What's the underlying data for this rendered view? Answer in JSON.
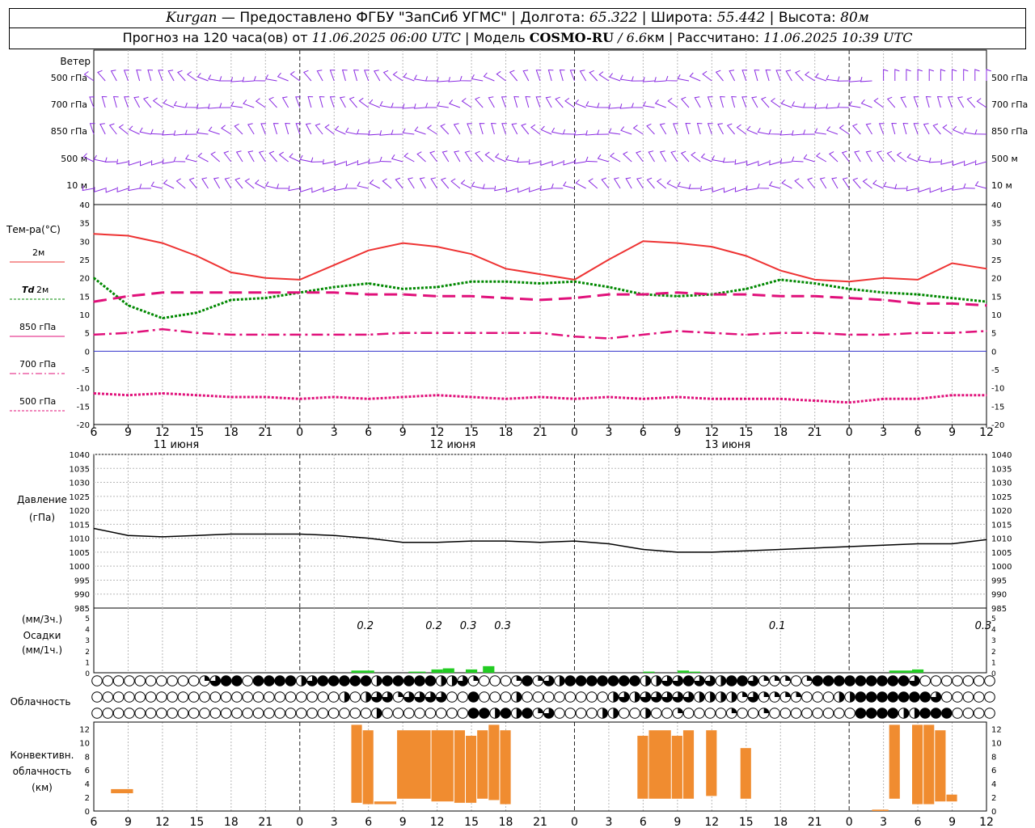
{
  "header": {
    "station": "Kurgan",
    "dash": " — ",
    "provider": "Предоставлено ФГБУ \"ЗапСиб УГМС\"",
    "sep": " | ",
    "lon_label": "Долгота: ",
    "lon_value": "65.322",
    "lat_label": "Широта: ",
    "lat_value": "55.442",
    "alt_label": "Высота: ",
    "alt_value": "80м",
    "forecast_label": "Прогноз на 120 часа(ов) от ",
    "forecast_time": "11.06.2025 06:00 UTC",
    "model_label": "Модель ",
    "model_name": "COSMO-RU",
    "model_res_sep": " / ",
    "model_res": "6.6",
    "model_res_unit": "км",
    "calc_label": "Рассчитано: ",
    "calc_time": "11.06.2025 10:39 UTC"
  },
  "chart_data": [
    {
      "type": "wind-barbs",
      "label": "Ветер",
      "levels": [
        "500 гПа",
        "700 гПа",
        "850 гПа",
        "500 м",
        "10 м"
      ],
      "barb_color": "#8a2be2"
    },
    {
      "type": "line",
      "label": "Тем-ра(°C)",
      "ylim": [
        -20,
        40
      ],
      "yticks": [
        -20,
        -15,
        -10,
        -5,
        0,
        5,
        10,
        15,
        20,
        25,
        30,
        35,
        40
      ],
      "x_hours": [
        0,
        3,
        6,
        9,
        12,
        15,
        18,
        21,
        24,
        27,
        30,
        33,
        36,
        39,
        42,
        45,
        48,
        51,
        54,
        57,
        60,
        63,
        66,
        69,
        72,
        75,
        78
      ],
      "series": [
        {
          "name": "2м",
          "color": "#ee3333",
          "style": "solid",
          "values": [
            32,
            31.5,
            29.5,
            26,
            21.5,
            20,
            19.5,
            23.5,
            27.5,
            29.5,
            28.5,
            26.5,
            22.5,
            21,
            19.5,
            25,
            30,
            29.5,
            28.5,
            26,
            22,
            19.5,
            19,
            20,
            19.5,
            24,
            22.5
          ]
        },
        {
          "name": "Td 2м",
          "color": "#008800",
          "style": "dotted",
          "values": [
            20,
            12.5,
            9,
            10.5,
            14,
            14.5,
            16,
            17.5,
            18.5,
            17,
            17.5,
            19,
            19,
            18.5,
            19,
            17.5,
            15.5,
            15,
            15.5,
            17,
            19.5,
            18.5,
            17,
            16,
            15.5,
            14.5,
            13.5
          ]
        },
        {
          "name": "850 гПа",
          "color": "#e0107a",
          "style": "dashed",
          "values": [
            13.5,
            15,
            16,
            16,
            16,
            16,
            16,
            16,
            15.5,
            15.5,
            15,
            15,
            14.5,
            14,
            14.5,
            15.5,
            15.5,
            16,
            15.5,
            15.5,
            15,
            15,
            14.5,
            14,
            13,
            13,
            12.5
          ]
        },
        {
          "name": "700 гПа",
          "color": "#e0107a",
          "style": "dashdot",
          "values": [
            4.5,
            5,
            6,
            5,
            4.5,
            4.5,
            4.5,
            4.5,
            4.5,
            5,
            5,
            5,
            5,
            5,
            4,
            3.5,
            4.5,
            5.5,
            5,
            4.5,
            5,
            5,
            4.5,
            4.5,
            5,
            5,
            5.5
          ]
        },
        {
          "name": "500 гПа",
          "color": "#e0107a",
          "style": "dotted",
          "values": [
            -11.5,
            -12,
            -11.5,
            -12,
            -12.5,
            -12.5,
            -13,
            -12.5,
            -13,
            -12.5,
            -12,
            -12.5,
            -13,
            -12.5,
            -13,
            -12.5,
            -13,
            -12.5,
            -13,
            -13,
            -13,
            -13.5,
            -14,
            -13,
            -13,
            -12,
            -12
          ]
        }
      ],
      "day_labels": [
        "11 июня",
        "12 июня",
        "13 июня"
      ],
      "x_tick_labels": [
        "6",
        "9",
        "12",
        "15",
        "18",
        "21",
        "0",
        "3",
        "6",
        "9",
        "12",
        "15",
        "18",
        "21",
        "0",
        "3",
        "6",
        "9",
        "12",
        "15",
        "18",
        "21",
        "0",
        "3",
        "6",
        "9",
        "12"
      ]
    },
    {
      "type": "line",
      "label": "Давление",
      "unit": "(гПа)",
      "ylim": [
        985,
        1040
      ],
      "yticks": [
        985,
        990,
        995,
        1000,
        1005,
        1010,
        1015,
        1020,
        1025,
        1030,
        1035,
        1040
      ],
      "x_hours": [
        0,
        3,
        6,
        9,
        12,
        15,
        18,
        21,
        24,
        27,
        30,
        33,
        36,
        39,
        42,
        45,
        48,
        51,
        54,
        57,
        60,
        63,
        66,
        69,
        72,
        75,
        78
      ],
      "series": [
        {
          "name": "",
          "color": "#000000",
          "values": [
            1013.5,
            1011,
            1010.5,
            1011,
            1011.5,
            1011.5,
            1011.5,
            1011,
            1010,
            1008.5,
            1008.5,
            1009,
            1009,
            1008.5,
            1009,
            1008,
            1006,
            1005,
            1005,
            1005.5,
            1006,
            1006.5,
            1007,
            1007.5,
            1008,
            1008,
            1009.5
          ]
        }
      ]
    },
    {
      "type": "bar",
      "label": "Осадки",
      "units": [
        "(мм/3ч.)",
        "(мм/1ч.)"
      ],
      "ylim": [
        0,
        5
      ],
      "yticks": [
        0,
        1,
        2,
        3,
        4,
        5
      ],
      "color": "#22cc22",
      "annotations": [
        {
          "hour": 24,
          "text": "0.2"
        },
        {
          "hour": 30,
          "text": "0.2"
        },
        {
          "hour": 33,
          "text": "0.3"
        },
        {
          "hour": 36,
          "text": "0.3"
        },
        {
          "hour": 60,
          "text": "0.1"
        },
        {
          "hour": 78,
          "text": "0.3"
        }
      ],
      "bars": [
        {
          "hour": 22.5,
          "w": 2,
          "value": 0.2
        },
        {
          "hour": 27.5,
          "w": 1.5,
          "value": 0.1
        },
        {
          "hour": 29.5,
          "w": 1,
          "value": 0.3
        },
        {
          "hour": 30.5,
          "w": 1,
          "value": 0.4
        },
        {
          "hour": 32.5,
          "w": 1,
          "value": 0.3
        },
        {
          "hour": 34,
          "w": 1,
          "value": 0.6
        },
        {
          "hour": 48,
          "w": 1,
          "value": 0.1
        },
        {
          "hour": 51,
          "w": 1,
          "value": 0.2
        },
        {
          "hour": 52,
          "w": 1,
          "value": 0.1
        },
        {
          "hour": 69.5,
          "w": 2,
          "value": 0.2
        },
        {
          "hour": 71.5,
          "w": 1,
          "value": 0.3
        }
      ]
    },
    {
      "type": "cloud-cover",
      "label": "Облачность",
      "rows": [
        "000000000013440444423444442444442231000141324444444223343324431110144444444430000000",
        "000000000000000000000002023313333004000200000000232333332222131111000224444444300000",
        "000000000000000000000000002000000004424241300002200200100001001000000004444224440000"
      ]
    },
    {
      "type": "bar",
      "label": "Конвективн. облачность (км)",
      "ylim": [
        0,
        13
      ],
      "yticks": [
        0,
        2,
        4,
        6,
        8,
        10,
        12
      ],
      "color": "#f08c30",
      "bars": [
        {
          "h0": 1.5,
          "h1": 3.5,
          "base": 2.6,
          "top": 3.2
        },
        {
          "h0": 22.5,
          "h1": 23.5,
          "base": 1.2,
          "top": 12.6
        },
        {
          "h0": 23.5,
          "h1": 24.5,
          "base": 1.0,
          "top": 11.8
        },
        {
          "h0": 24.5,
          "h1": 26.5,
          "base": 1.0,
          "top": 1.4
        },
        {
          "h0": 26.5,
          "h1": 29.5,
          "base": 1.8,
          "top": 11.8
        },
        {
          "h0": 29.5,
          "h1": 31.5,
          "base": 1.4,
          "top": 11.8
        },
        {
          "h0": 31.5,
          "h1": 32.5,
          "base": 1.2,
          "top": 11.8
        },
        {
          "h0": 32.5,
          "h1": 33.5,
          "base": 1.2,
          "top": 11.0
        },
        {
          "h0": 33.5,
          "h1": 34.5,
          "base": 1.8,
          "top": 11.8
        },
        {
          "h0": 34.5,
          "h1": 35.5,
          "base": 1.6,
          "top": 12.6
        },
        {
          "h0": 35.5,
          "h1": 36.5,
          "base": 1.0,
          "top": 11.8
        },
        {
          "h0": 47.5,
          "h1": 48.5,
          "base": 1.8,
          "top": 11.0
        },
        {
          "h0": 48.5,
          "h1": 50.5,
          "base": 1.8,
          "top": 11.8
        },
        {
          "h0": 50.5,
          "h1": 51.5,
          "base": 1.8,
          "top": 11.0
        },
        {
          "h0": 51.5,
          "h1": 52.5,
          "base": 1.8,
          "top": 11.8
        },
        {
          "h0": 53.5,
          "h1": 54.5,
          "base": 2.2,
          "top": 11.8
        },
        {
          "h0": 56.5,
          "h1": 57.5,
          "base": 1.8,
          "top": 9.2
        },
        {
          "h0": 68,
          "h1": 69.5,
          "base": 0.0,
          "top": 0.2
        },
        {
          "h0": 69.5,
          "h1": 70.5,
          "base": 1.8,
          "top": 12.6
        },
        {
          "h0": 71.5,
          "h1": 72.5,
          "base": 1.0,
          "top": 12.6
        },
        {
          "h0": 72.5,
          "h1": 73.5,
          "base": 1.0,
          "top": 12.6
        },
        {
          "h0": 73.5,
          "h1": 74.5,
          "base": 1.4,
          "top": 11.8
        },
        {
          "h0": 74.5,
          "h1": 75.5,
          "base": 1.4,
          "top": 2.4
        }
      ]
    }
  ],
  "x_axis": {
    "start_hour": 6,
    "tick_step_hours": 3,
    "tick_labels": [
      "6",
      "9",
      "12",
      "15",
      "18",
      "21",
      "0",
      "3",
      "6",
      "9",
      "12",
      "15",
      "18",
      "21",
      "0",
      "3",
      "6",
      "9",
      "12",
      "15",
      "18",
      "21",
      "0",
      "3",
      "6",
      "9",
      "12"
    ]
  },
  "legend": {
    "t2m": "2м",
    "td_sym": "Td",
    "td_unit": " 2м",
    "p850": "850 гПа",
    "p700": "700 гПа",
    "p500": "500 гПа"
  },
  "colors": {
    "wind": "#8a2be2",
    "t2m": "#ee3333",
    "td": "#008800",
    "pressure_levels": "#e0107a",
    "zero_line": "#3333cc",
    "precip": "#22cc22",
    "convective": "#f08c30"
  }
}
